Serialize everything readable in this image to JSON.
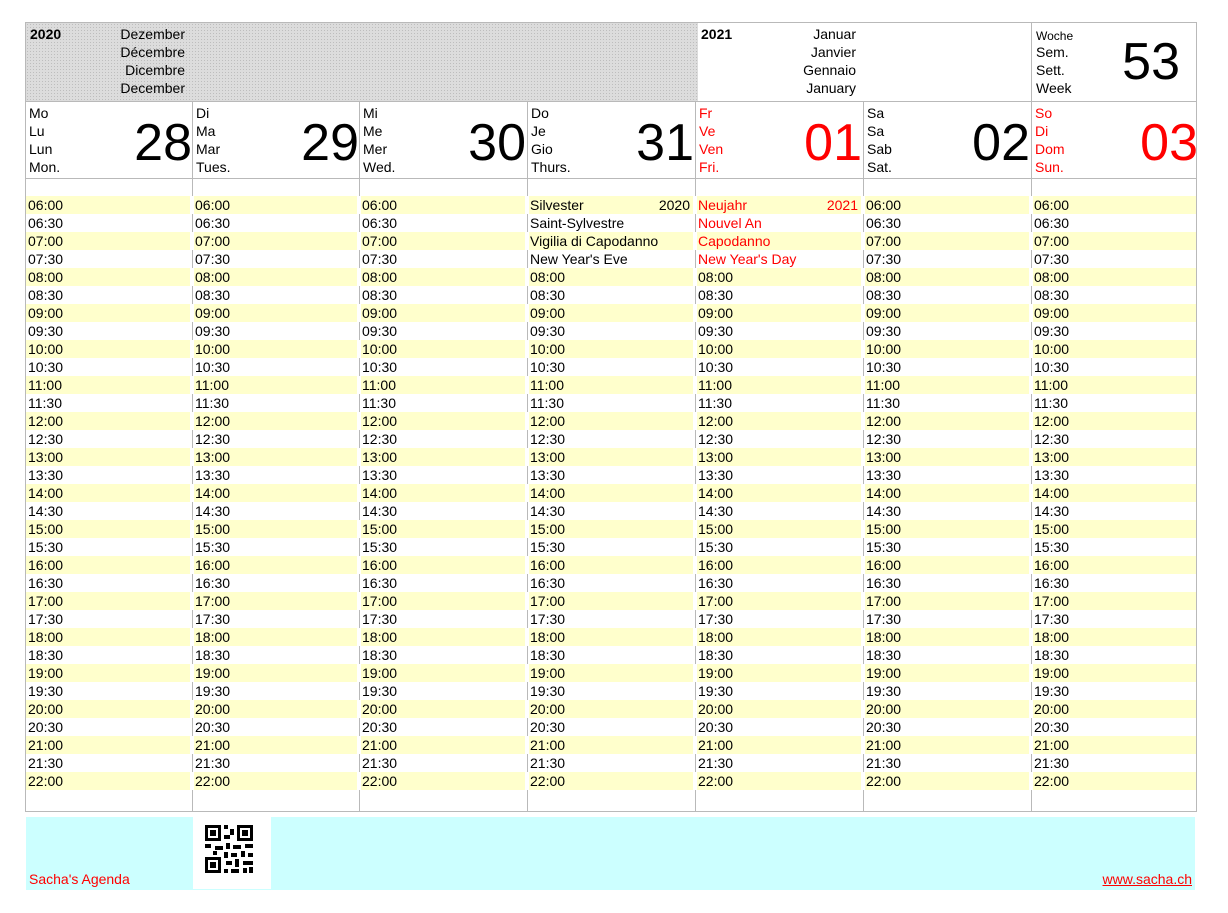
{
  "header": {
    "year_left": "2020",
    "months_left": [
      "Dezember",
      "Décembre",
      "Dicembre",
      "December"
    ],
    "year_right": "2021",
    "months_right": [
      "Januar",
      "Janvier",
      "Gennaio",
      "January"
    ],
    "week_labels": [
      "Woche",
      "Sem.",
      "Sett.",
      "Week"
    ],
    "week_number": "53"
  },
  "days": [
    {
      "labels": [
        "Mo",
        "Lu",
        "Lun",
        "Mon."
      ],
      "number": "28",
      "holiday": false
    },
    {
      "labels": [
        "Di",
        "Ma",
        "Mar",
        "Tues."
      ],
      "number": "29",
      "holiday": false
    },
    {
      "labels": [
        "Mi",
        "Me",
        "Mer",
        "Wed."
      ],
      "number": "30",
      "holiday": false
    },
    {
      "labels": [
        "Do",
        "Je",
        "Gio",
        "Thurs."
      ],
      "number": "31",
      "holiday": false
    },
    {
      "labels": [
        "Fr",
        "Ve",
        "Ven",
        "Fri."
      ],
      "number": "01",
      "holiday": true
    },
    {
      "labels": [
        "Sa",
        "Sa",
        "Sab",
        "Sat."
      ],
      "number": "02",
      "holiday": false
    },
    {
      "labels": [
        "So",
        "Di",
        "Dom",
        "Sun."
      ],
      "number": "03",
      "holiday": true
    }
  ],
  "events": [
    {
      "day_index": 3,
      "lines": [
        "Silvester",
        "Saint-Sylvestre",
        "Vigilia di Capodanno",
        "New Year's Eve"
      ],
      "year": "2020"
    },
    {
      "day_index": 4,
      "lines": [
        "Neujahr",
        "Nouvel An",
        "Capodanno",
        "New Year's Day"
      ],
      "year": "2021"
    }
  ],
  "times": [
    "06:00",
    "06:30",
    "07:00",
    "07:30",
    "08:00",
    "08:30",
    "09:00",
    "09:30",
    "10:00",
    "10:30",
    "11:00",
    "11:30",
    "12:00",
    "12:30",
    "13:00",
    "13:30",
    "14:00",
    "14:30",
    "15:00",
    "15:30",
    "16:00",
    "16:30",
    "17:00",
    "17:30",
    "18:00",
    "18:30",
    "19:00",
    "19:30",
    "20:00",
    "20:30",
    "21:00",
    "21:30",
    "22:00"
  ],
  "footer": {
    "brand": "Sacha's Agenda",
    "url": "www.sacha.ch"
  },
  "colors": {
    "holiday_red": "#ff0000",
    "row_highlight": "#ffffcc",
    "footer_bg": "#ccffff",
    "header_gray": "#dcdcdc"
  }
}
